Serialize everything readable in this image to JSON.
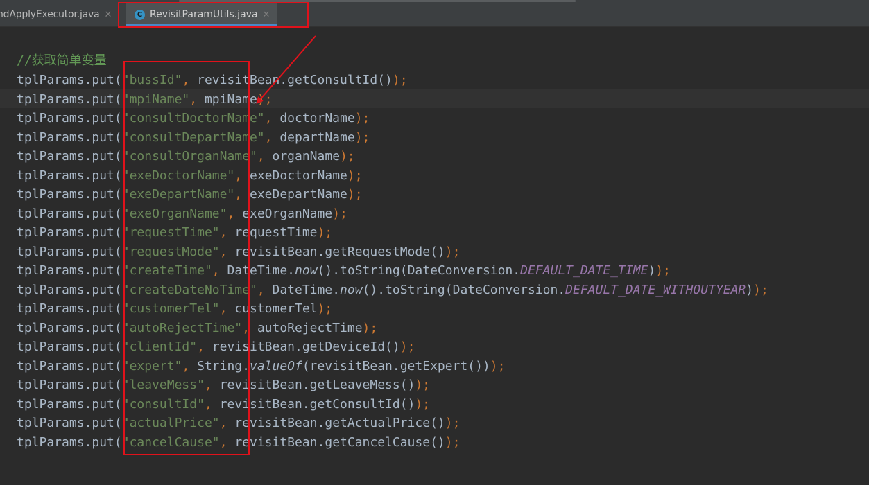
{
  "tabs": {
    "previous": {
      "label": "ndApplyExecutor.java"
    },
    "active": {
      "label": "RevisitParamUtils.java",
      "icon_letter": "C"
    }
  },
  "code": {
    "comment": "//获取简单变量",
    "lines": [
      {
        "key": "\"bussId\"",
        "tail": "revisitBean.getConsultId()"
      },
      {
        "key": "\"mpiName\"",
        "tail": "mpiName"
      },
      {
        "key": "\"consultDoctorName\"",
        "tail": "doctorName"
      },
      {
        "key": "\"consultDepartName\"",
        "tail": "departName"
      },
      {
        "key": "\"consultOrganName\"",
        "tail": "organName"
      },
      {
        "key": "\"exeDoctorName\"",
        "tail": "exeDoctorName"
      },
      {
        "key": "\"exeDepartName\"",
        "tail": "exeDepartName"
      },
      {
        "key": "\"exeOrganName\"",
        "tail": "exeOrganName"
      },
      {
        "key": "\"requestTime\"",
        "tail": "requestTime"
      },
      {
        "key": "\"requestMode\"",
        "tail": "revisitBean.getRequestMode()"
      },
      {
        "key": "\"createTime\"",
        "tail_a": "DateTime.",
        "tail_b": "now",
        "tail_c": "().toString(DateConversion.",
        "tail_field": "DEFAULT_DATE_TIME",
        "tail_d": ")"
      },
      {
        "key": "\"createDateNoTime\"",
        "tail_a": "DateTime.",
        "tail_b": "now",
        "tail_c": "().toString(DateConversion.",
        "tail_field": "DEFAULT_DATE_WITHOUTYEAR",
        "tail_d": ")"
      },
      {
        "key": "\"customerTel\"",
        "tail": "customerTel"
      },
      {
        "key": "\"autoRejectTime\"",
        "tail": "autoRejectTime"
      },
      {
        "key": "\"clientId\"",
        "tail": "revisitBean.getDeviceId()"
      },
      {
        "key": "\"expert\"",
        "tail_a": "String.",
        "tail_b": "valueOf",
        "tail_c": "(revisitBean.getExpert())"
      },
      {
        "key": "\"leaveMess\"",
        "tail": "revisitBean.getLeaveMess()"
      },
      {
        "key": "\"consultId\"",
        "tail": "revisitBean.getConsultId()"
      },
      {
        "key": "\"actualPrice\"",
        "tail": "revisitBean.getActualPrice()"
      },
      {
        "key": "\"cancelCause\"",
        "tail": "revisitBean.getCancelCause()"
      }
    ],
    "receiver": "tplParams.put",
    "open_paren": "(",
    "comma": ", ",
    "close": ");",
    "close_paren": ")"
  },
  "colors": {
    "background": "#2b2b2b",
    "string": "#6a8759",
    "keyword_punct": "#cc7832",
    "field": "#9876aa",
    "identifier": "#a9b7c6",
    "annotation": "#e0121b"
  }
}
